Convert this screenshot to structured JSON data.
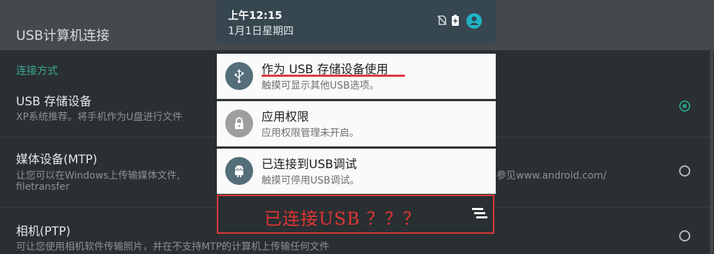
{
  "background": {
    "title": "USB计算机连接",
    "section_label": "连接方式",
    "options": [
      {
        "title": "USB 存储设备",
        "desc": "XP系统推荐。将手机作为U盘进行文件",
        "selected": true
      },
      {
        "title": "媒体设备(MTP)",
        "desc_line1": "让您可以在Windows上传输媒体文件,",
        "desc_line1_right": "参见www.android.com/",
        "desc_line2": "filetransfer",
        "selected": false
      },
      {
        "title": "相机(PTP)",
        "desc": "可让您使用相机软件传输照片，并在不支持MTP的计算机上传输任何文件",
        "selected": false
      }
    ]
  },
  "status_bar": {
    "time": "上午12:15",
    "date": "1月1日星期四"
  },
  "notifications": [
    {
      "title": "作为 USB 存储设备使用",
      "subtitle": "触摸可显示其他USB选项。",
      "icon": "usb-icon",
      "icon_bg": "#546e7a"
    },
    {
      "title": "应用权限",
      "subtitle": "应用权限管理未开启。",
      "icon": "lock-icon",
      "icon_bg": "#9e9e9e"
    },
    {
      "title": "已连接到USB调试",
      "subtitle": "触摸可停用USB调试。",
      "icon": "android-icon",
      "icon_bg": "#546e7a"
    }
  ],
  "annotation": {
    "text": "已连接USB ？？？",
    "color": "#e03838"
  },
  "colors": {
    "accent": "#2a9c87",
    "status_bar": "#37474f",
    "annotation_red": "#e03838"
  }
}
